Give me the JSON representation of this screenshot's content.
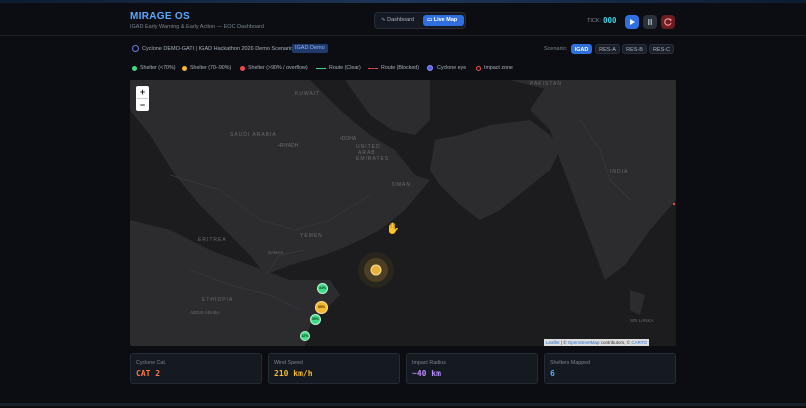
{
  "app": {
    "title": "MIRAGE OS",
    "subtitle": "IGAD Early Warning & Early Action — EOC Dashboard"
  },
  "nav": {
    "dashboard_label": "Dashboard",
    "livemap_label": "Live Map",
    "active": "Live Map"
  },
  "tick": {
    "label": "TICK:",
    "value": "000"
  },
  "controls": {
    "play_icon": "play-icon",
    "pause_icon": "pause-icon",
    "reset_icon": "reset-icon"
  },
  "scenario": {
    "description": "Cyclone DEMO-GATI | IGAD Hackathon 2026 Demo Scenario",
    "badge": "IGAD Demo",
    "selector_label": "Scenario:",
    "options": [
      "IGAD",
      "RES-A",
      "RES-B",
      "RES-C"
    ],
    "selected": "IGAD"
  },
  "legend": {
    "items": [
      {
        "label": "Shelter (<70%)",
        "color": "#3ddc84"
      },
      {
        "label": "Shelter (70–90%)",
        "color": "#f5b82e"
      },
      {
        "label": "Shelter (>90% / overflow)",
        "color": "#f04b4b"
      },
      {
        "label": "Route (Clear)",
        "color": "#3ddc84"
      },
      {
        "label": "Route (Blocked)",
        "color": "#f04b4b"
      },
      {
        "label": "Cyclone eye",
        "color": "#6b6fff"
      },
      {
        "label": "Impact zone",
        "color": "#f04b4b"
      }
    ]
  },
  "map": {
    "zoom_in": "+",
    "zoom_out": "−",
    "attribution": {
      "leaflet": "Leaflet",
      "sep1": " | © ",
      "osm": "OpenStreetMap",
      "contrib": " contributors, © ",
      "carto": "CARTO"
    },
    "labels": {
      "pakistan": "PAKISTAN",
      "kuwait": "KUWAIT",
      "saudi": "SAUDI ARABIA",
      "doha": "•DOHA",
      "uae1": "UNITED",
      "uae2": "ARAB",
      "uae3": "EMIRATES",
      "oman": "OMAN",
      "riyadh": "•RIYADH",
      "india": "INDIA",
      "yemen": "YEMEN",
      "eritrea": "ERITREA",
      "ethiopia": "ETHIOPIA",
      "sanaa": "SANAA",
      "addis": "ADDIS ABABA",
      "srilanka": "SRI LANKA"
    },
    "shelters": [
      {
        "label": "34%",
        "status": "ok"
      },
      {
        "label": "85%",
        "status": "warn"
      },
      {
        "label": "55%",
        "status": "ok"
      },
      {
        "label": "42%",
        "status": "ok"
      }
    ]
  },
  "cards": [
    {
      "label": "Cyclone Cat.",
      "value": "CAT 2",
      "color": "#ff7a45"
    },
    {
      "label": "Wind Speed",
      "value": "210 km/h",
      "color": "#f5b82e"
    },
    {
      "label": "Impact Radius",
      "value": "~40 km",
      "color": "#b98cff"
    },
    {
      "label": "Shelters Mapped",
      "value": "6",
      "color": "#5aa9ff"
    }
  ]
}
